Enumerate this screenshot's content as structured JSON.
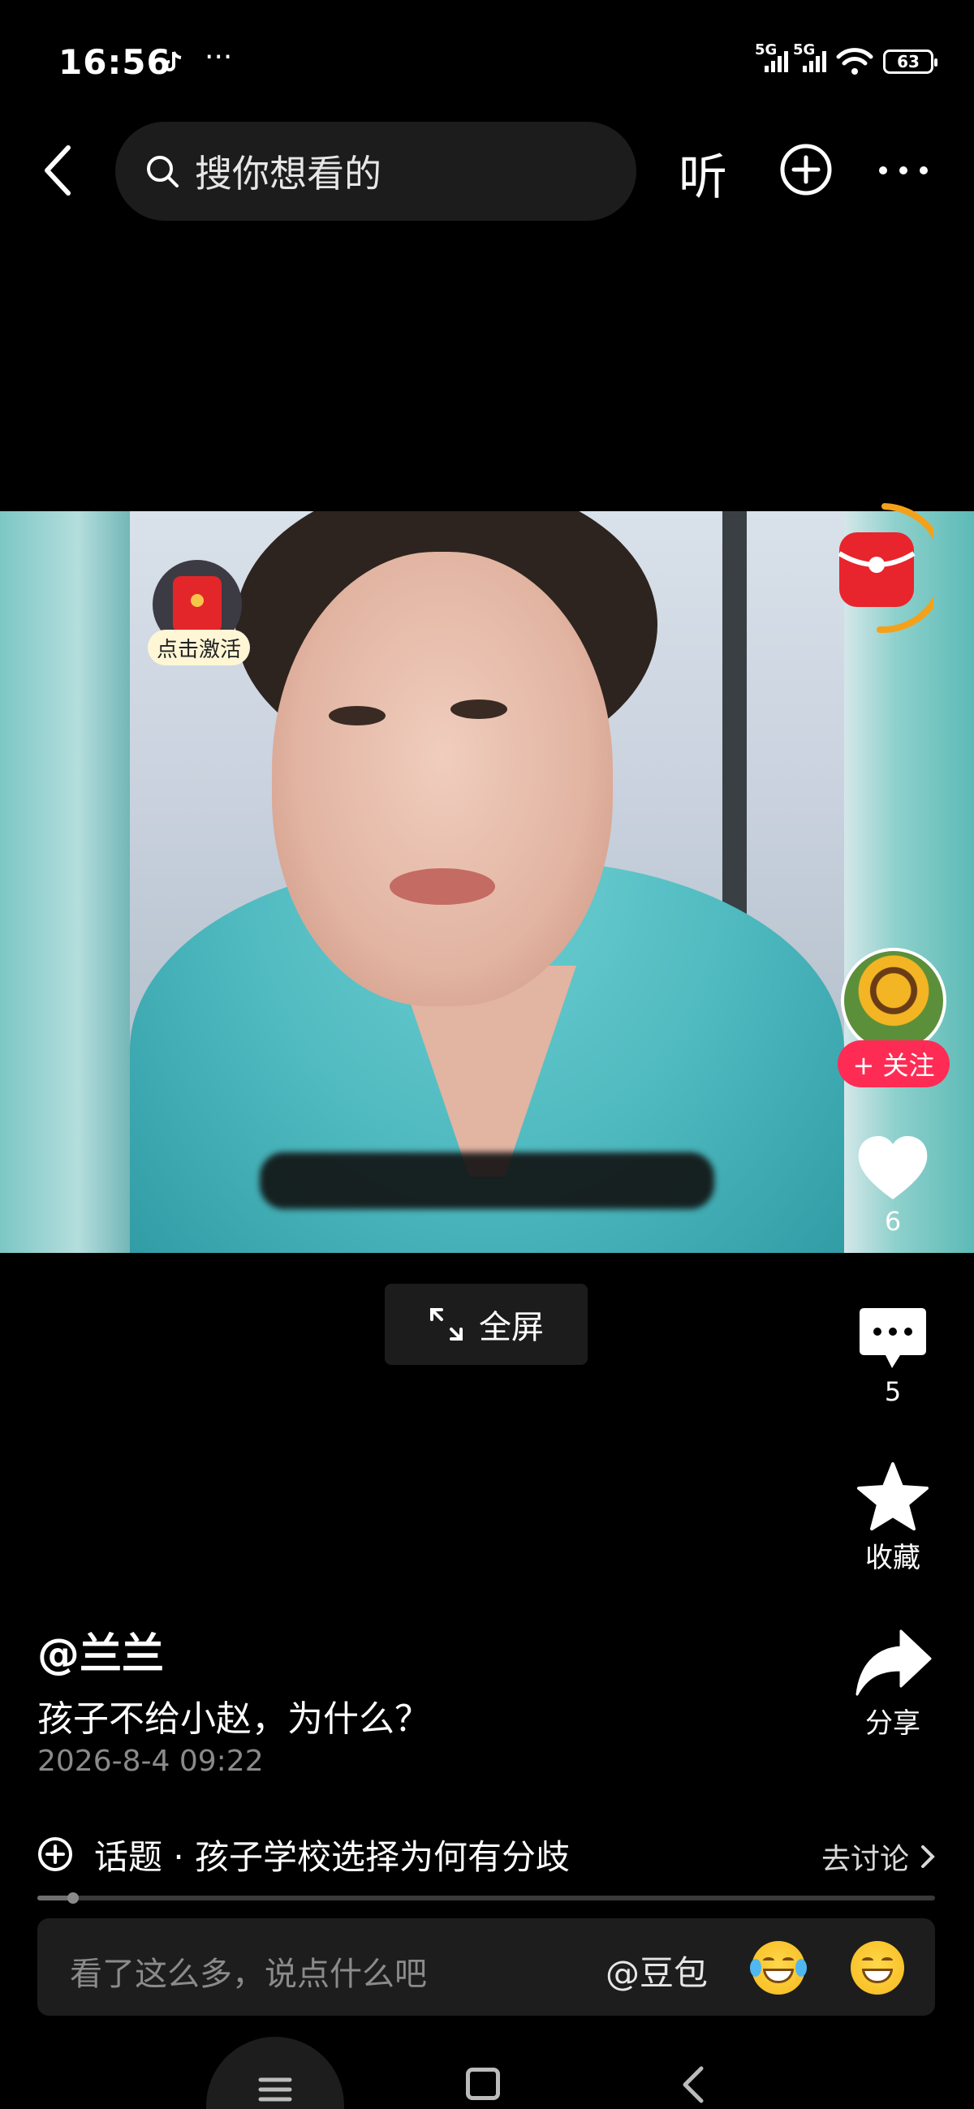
{
  "status_bar": {
    "time": "16:56",
    "more": "···",
    "signal_label_1": "5G",
    "signal_label_2": "5G",
    "battery": "63"
  },
  "top_nav": {
    "search_placeholder": "搜你想看的",
    "listen_label": "听"
  },
  "video": {
    "activate_label": "点击激活",
    "fullscreen_label": "全屏"
  },
  "right_rail": {
    "follow_label": "+ 关注",
    "like_count": "6",
    "comment_count": "5",
    "favorite_label": "收藏",
    "share_label": "分享"
  },
  "post": {
    "author": "@兰兰",
    "caption": "孩子不给小赵，为什么？",
    "datetime": "2026-8-4 09:22"
  },
  "topic": {
    "text": "话题 · 孩子学校选择为何有分歧",
    "action": "去讨论"
  },
  "playback": {
    "progress": 0.04
  },
  "comment_bar": {
    "placeholder": "看了这么多，说点什么吧",
    "mention": "@豆包"
  },
  "colors": {
    "accent_red": "#fe2c55",
    "background": "#000000"
  },
  "icons": [
    "back-icon",
    "search-icon",
    "add-icon",
    "more-icon",
    "redpacket-icon",
    "heart-icon",
    "comment-icon",
    "star-icon",
    "share-icon",
    "fullscreen-icon",
    "topic-icon",
    "chevron-right-icon",
    "emoji-laugh-cry-icon",
    "emoji-grin-icon",
    "menu-icon",
    "home-square-icon",
    "nav-back-icon"
  ]
}
